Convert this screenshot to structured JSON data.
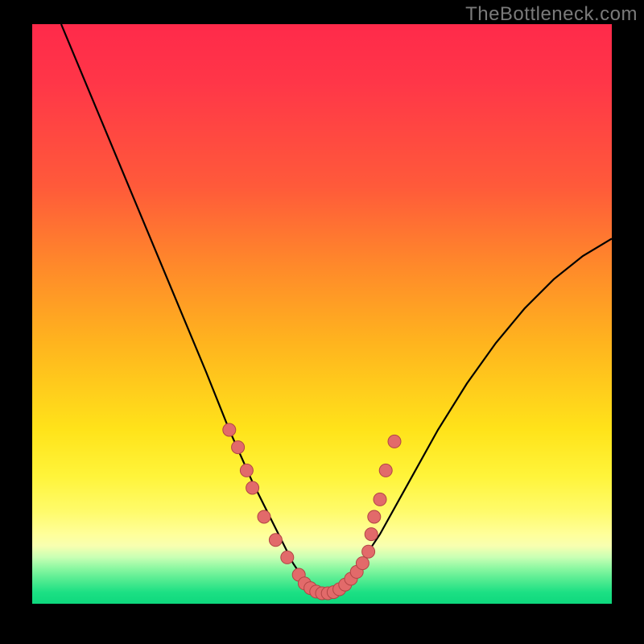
{
  "watermark": "TheBottleneck.com",
  "colors": {
    "background": "#000000",
    "curve_stroke": "#000000",
    "marker_fill": "#e26a6a",
    "marker_stroke": "#b24545",
    "gradient_top": "#ff2a4a",
    "gradient_mid": "#ffe31a",
    "gradient_bottom": "#0ed87d"
  },
  "chart_data": {
    "type": "line",
    "title": "",
    "xlabel": "",
    "ylabel": "",
    "xlim": [
      0,
      100
    ],
    "ylim": [
      0,
      100
    ],
    "grid": false,
    "legend": false,
    "series": [
      {
        "name": "bottleneck-curve",
        "x": [
          5,
          10,
          15,
          20,
          25,
          30,
          34,
          38,
          42,
          45,
          47,
          49,
          50,
          51,
          53,
          56,
          60,
          65,
          70,
          75,
          80,
          85,
          90,
          95,
          100
        ],
        "y": [
          100,
          88,
          76,
          64,
          52,
          40,
          30,
          21,
          13,
          7,
          4,
          2,
          1.5,
          2,
          3,
          6,
          12,
          21,
          30,
          38,
          45,
          51,
          56,
          60,
          63
        ]
      }
    ],
    "markers": {
      "name": "sample-points",
      "x": [
        34,
        35.5,
        37,
        38,
        40,
        42,
        44,
        46,
        47,
        48,
        49,
        50,
        51,
        52,
        53,
        54,
        55,
        56,
        57,
        58,
        58.5,
        59,
        60,
        61,
        62.5
      ],
      "y": [
        30,
        27,
        23,
        20,
        15,
        11,
        8,
        5,
        3.5,
        2.7,
        2.1,
        1.8,
        1.8,
        2,
        2.5,
        3.3,
        4.3,
        5.5,
        7,
        9,
        12,
        15,
        18,
        23,
        28
      ]
    }
  }
}
